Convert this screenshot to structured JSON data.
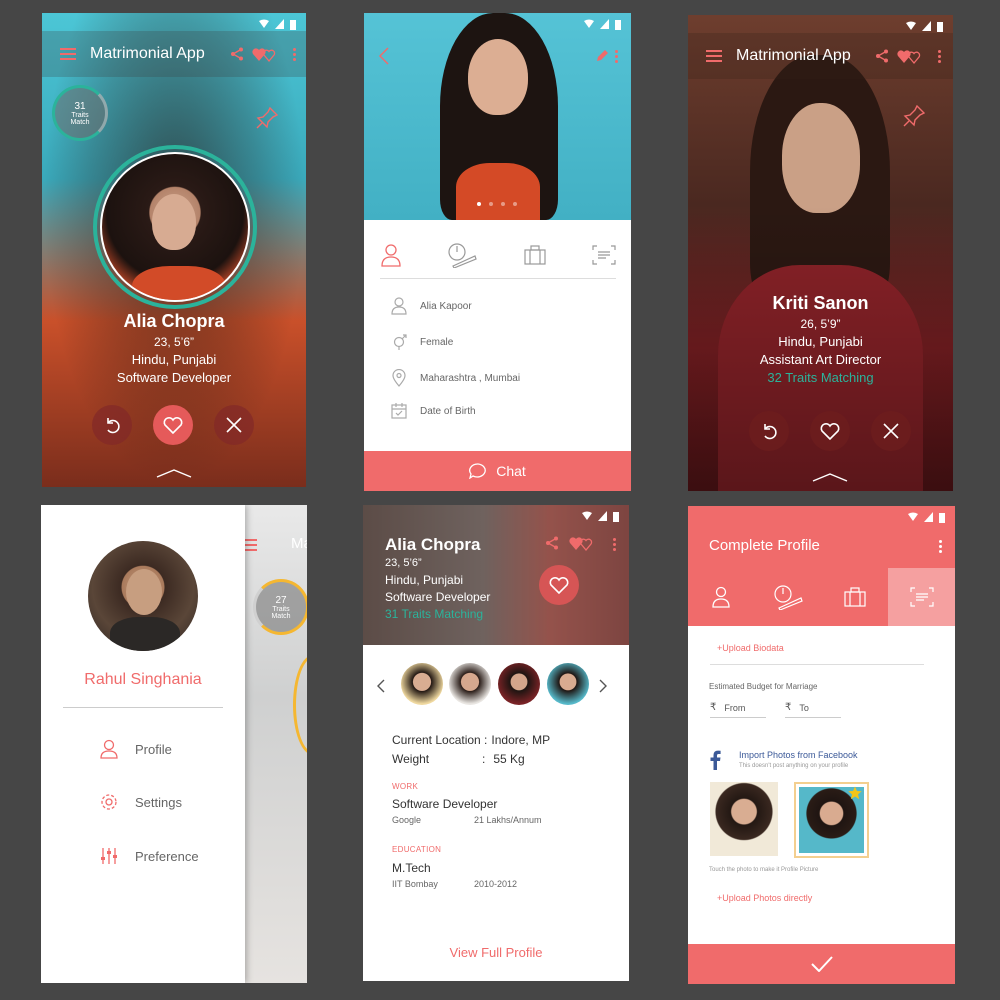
{
  "colors": {
    "accent": "#f06b6b",
    "teal": "#2bb39b",
    "background": "#464646"
  },
  "app": {
    "title": "Matrimonial App"
  },
  "card1": {
    "traits_count": "31",
    "traits_line1": "Traits",
    "traits_line2": "Match",
    "name": "Alia Chopra",
    "age_height": "23, 5’6”",
    "religion": "Hindu, Punjabi",
    "profession": "Software Developer",
    "icons": [
      "menu-icon",
      "share-icon",
      "hearts-icon",
      "more-icon",
      "pin-icon",
      "undo-icon",
      "heart-icon",
      "close-icon",
      "chevron-up-icon"
    ]
  },
  "card2": {
    "tabs": [
      "person-icon",
      "measure-icon",
      "briefcase-icon",
      "id-icon"
    ],
    "fields": [
      "Alia Kapoor",
      "Female",
      "Maharashtra , Mumbai",
      "Date of Birth"
    ],
    "carousel_dots": 4,
    "chat_label": "Chat"
  },
  "card3": {
    "name": "Kriti Sanon",
    "age_height": "26, 5’9”",
    "religion": "Hindu, Punjabi",
    "profession": "Assistant Art Director",
    "traits": "32 Traits Matching"
  },
  "card4": {
    "user_name": "Rahul Singhania",
    "menu": [
      "Profile",
      "Settings",
      "Preference"
    ],
    "bg_traits_count": "27",
    "bg_traits_line1": "Traits",
    "bg_traits_line2": "Match",
    "bg_title": "Ma"
  },
  "card5": {
    "name": "Alia Chopra",
    "age_height": "23, 5’6”",
    "religion": "Hindu, Punjabi",
    "profession": "Software Developer",
    "traits": "31 Traits Matching",
    "location_label": "Current Location :",
    "location_value": "Indore, MP",
    "weight_label": "Weight",
    "weight_colon": ":",
    "weight_value": "55 Kg",
    "work_label": "WORK",
    "job": "Software Developer",
    "company": "Google",
    "salary": "21 Lakhs/Annum",
    "education_label": "EDUCATION",
    "degree": "M.Tech",
    "college": "IIT Bombay",
    "years": "2010-2012",
    "view_full": "View Full Profile"
  },
  "card6": {
    "title": "Complete Profile",
    "upload_biodata": "+Upload Biodata",
    "budget_label": "Estimated Budget for Marriage",
    "rupee": "₹",
    "from_label": "From",
    "to_label": "To",
    "fb_import": "Import Photos from Facebook",
    "fb_note": "This doesn't post anything on your profile",
    "photo_hint": "Touch the photo to make it Profile Picture",
    "upload_direct": "+Upload Photos directly"
  }
}
